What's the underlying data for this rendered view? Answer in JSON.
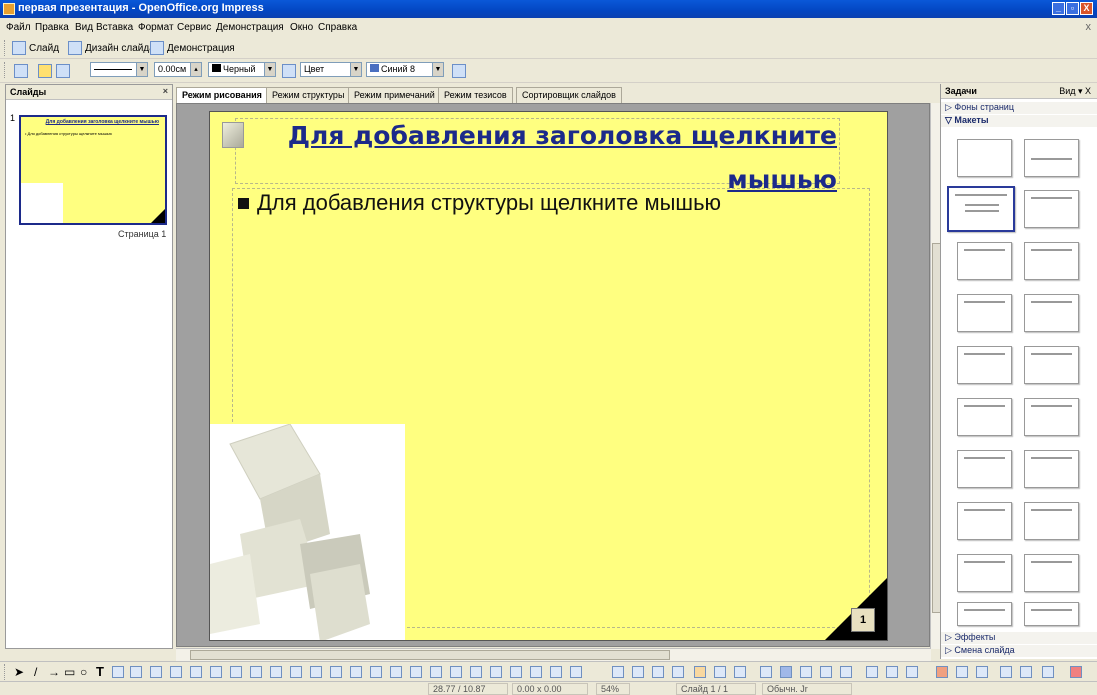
{
  "window": {
    "title": "первая презентация - OpenOffice.org Impress",
    "controls": [
      "_",
      "▫",
      "X"
    ]
  },
  "menubar": {
    "items": [
      "Файл",
      "Правка",
      "Вид",
      "Вставка",
      "Формат",
      "Сервис",
      "Демонстрация",
      "Окно",
      "Справка"
    ],
    "close": "x"
  },
  "toolbar1": {
    "slide": "Слайд",
    "design": "Дизайн слайда",
    "show": "Демонстрация"
  },
  "toolbar2": {
    "line_width": "0.00см",
    "line_color": "Черный",
    "area_style": "Цвет",
    "area_color": "Синий 8"
  },
  "slides_pane": {
    "title": "Слайды",
    "close": "×",
    "slide_number": "1",
    "page_label": "Страница 1",
    "thumb_title": "Для добавления заголовка щелкните мышью",
    "thumb_body": "• Для добавления структуры щелкните мышью"
  },
  "tabs": [
    "Режим рисования",
    "Режим структуры",
    "Режим примечаний",
    "Режим тезисов",
    "Сортировщик слайдов"
  ],
  "slide": {
    "title": "Для добавления заголовка щелкните мышью",
    "body": "Для добавления структуры щелкните мышью",
    "page_number": "1"
  },
  "tasks_pane": {
    "title": "Задачи",
    "view": "Вид ▾ X",
    "sections": {
      "backgrounds": "Фоны страниц",
      "layouts": "Макеты",
      "effects": "Эффекты",
      "transition": "Смена слайда"
    }
  },
  "statusbar": {
    "position": "28.77 / 10.87",
    "size": "0.00 x 0.00",
    "zoom": "54%",
    "page": "Слайд 1 / 1",
    "style": "Обычн. Jr"
  },
  "colors": {
    "title_blue": "#1c2a8a",
    "slide_yellow": "#ffff80",
    "xp_blue": "#0346c2"
  }
}
